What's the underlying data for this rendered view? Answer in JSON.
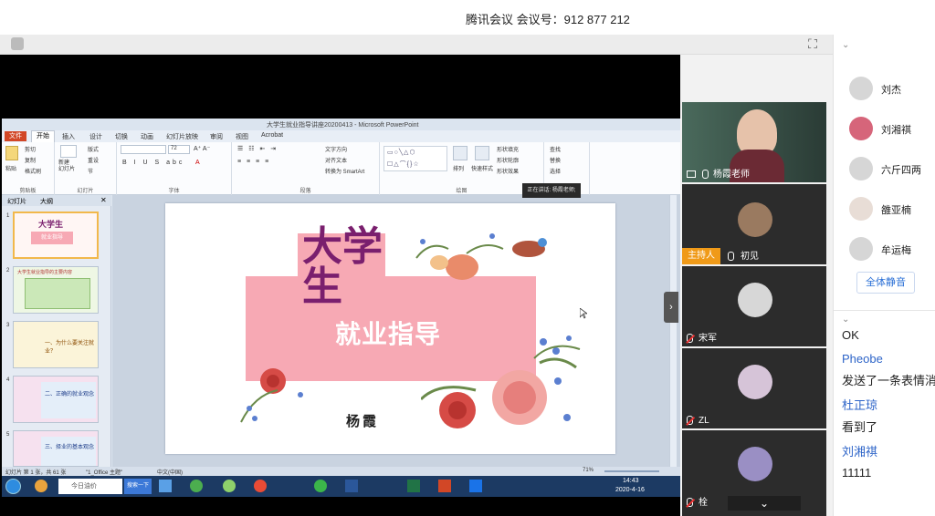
{
  "meeting": {
    "title": "腾讯会议 会议号：912 877 212"
  },
  "ppt": {
    "window_title": "大学生就业指导讲座20200413 - Microsoft PowerPoint",
    "tabs": [
      "文件",
      "开始",
      "插入",
      "设计",
      "切换",
      "动画",
      "幻灯片放映",
      "审阅",
      "视图",
      "Acrobat"
    ],
    "ribbon": {
      "paste": "粘贴",
      "cut": "剪切",
      "copy": "复制",
      "format_painter": "格式刷",
      "new_slide": "新建\n幻灯片",
      "layout": "版式",
      "reset": "重设",
      "section": "节",
      "font_size": "72",
      "text_direction": "文字方向",
      "align_text": "对齐文本",
      "smartart": "转换为 SmartArt",
      "arrange": "排列",
      "quick_styles": "快速样式",
      "shape_fill": "形状填充",
      "shape_outline": "形状轮廓",
      "shape_effects": "形状效果",
      "find": "查找",
      "replace": "替换",
      "select": "选择",
      "groups": [
        "剪贴板",
        "幻灯片",
        "字体",
        "段落",
        "绘图",
        "编辑"
      ]
    },
    "pane_tabs": [
      "幻灯片",
      "大纲"
    ],
    "slides": [
      {
        "num": "1",
        "title": "大学生",
        "subtitle": "就业指导"
      },
      {
        "num": "2",
        "title": "大学生就业指导的主要内容"
      },
      {
        "num": "3",
        "title": "一、为什么要关注就业？"
      },
      {
        "num": "4",
        "title": "二、正确的就业观念"
      },
      {
        "num": "5",
        "title": "三、择业的基本观念"
      }
    ],
    "slide": {
      "title_big": "大学生",
      "subtitle": "就业指导",
      "author": "杨霞"
    },
    "status": {
      "slide_info": "幻灯片 第 1 张，共 61 张",
      "theme": "\"1_Office 主题\"",
      "lang": "中文(中国)",
      "zoom": "71%"
    },
    "taskbar": {
      "search_placeholder": "今日油价",
      "search_button": "搜索一下",
      "time": "14:43",
      "date": "2020-4-16"
    },
    "speaking_tip": "正在讲话: 杨霞老师;"
  },
  "video": [
    {
      "name": "杨霞老师",
      "muted": false
    },
    {
      "name": "初见",
      "host_label": "主持人",
      "muted": false
    },
    {
      "name": "宋军",
      "muted": true
    },
    {
      "name": "ZL",
      "muted": true
    },
    {
      "name": "栓",
      "muted": true
    }
  ],
  "participants": [
    {
      "name": "刘杰"
    },
    {
      "name": "刘湘祺"
    },
    {
      "name": "六斤四两"
    },
    {
      "name": "雒亚楠"
    },
    {
      "name": "牟运梅"
    }
  ],
  "mute_all_label": "全体静音",
  "chat": [
    {
      "type": "msg",
      "text": "OK"
    },
    {
      "type": "name",
      "text": "Pheobe"
    },
    {
      "type": "msg",
      "text": "发送了一条表情消息"
    },
    {
      "type": "name",
      "text": "杜正琼"
    },
    {
      "type": "msg",
      "text": "看到了"
    },
    {
      "type": "name",
      "text": "刘湘祺"
    },
    {
      "type": "msg",
      "text": "11111"
    }
  ],
  "colors": {
    "accent": "#2a6fd6",
    "host_badge": "#f09a18",
    "slide_pink": "#f7a9b4",
    "slide_purple": "#7a1f6e"
  }
}
